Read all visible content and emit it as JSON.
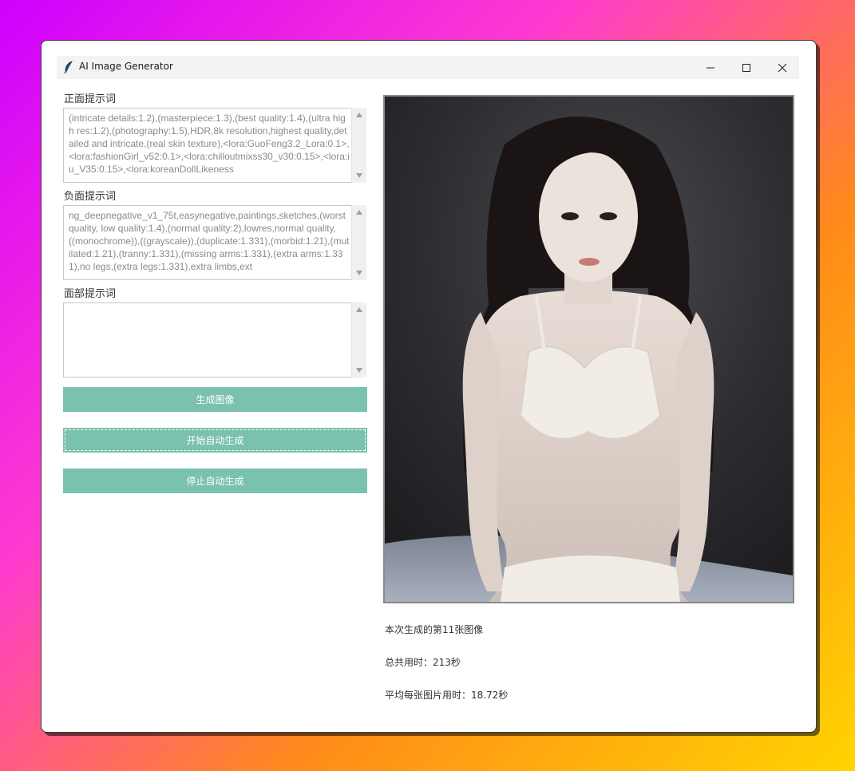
{
  "window": {
    "title": "AI Image Generator"
  },
  "prompts": {
    "positive_label": "正面提示词",
    "positive_value": "(intricate details:1.2),(masterpiece:1.3),(best quality:1.4),(ultra high res:1.2),(photography:1.5),HDR,8k resolution,highest quality,detailed and intricate,(real skin texture),<lora:GuoFeng3.2_Lora:0.1>,<lora:fashionGirl_v52:0.1>,<lora:chilloutmixss30_v30:0.15>,<lora:iu_V35:0.15>,<lora:koreanDollLikeness",
    "negative_label": "负面提示词",
    "negative_value": "ng_deepnegative_v1_75t,easynegative,paintings,sketches,(worst quality, low quality:1.4),(normal quality:2),lowres,normal quality,((monochrome)),((grayscale)),(duplicate:1.331),(morbid:1.21),(mutilated:1.21),(tranny:1.331),(missing arms:1.331),(extra arms:1.331),no legs,(extra legs:1.331),extra limbs,ext",
    "face_label": "面部提示词",
    "face_value": ""
  },
  "buttons": {
    "generate": "生成图像",
    "start_auto": "开始自动生成",
    "stop_auto": "停止自动生成"
  },
  "stats": {
    "count": "本次生成的第11张图像",
    "total_time": "总共用时：213秒",
    "avg_time": "平均每张图片用时：18.72秒"
  },
  "colors": {
    "button_bg": "#7ac2ae",
    "titlebar_bg": "#f3f3f3"
  },
  "icons": [
    "feather-icon",
    "minimize-icon",
    "maximize-icon",
    "close-icon",
    "scroll-up-icon",
    "scroll-down-icon"
  ]
}
